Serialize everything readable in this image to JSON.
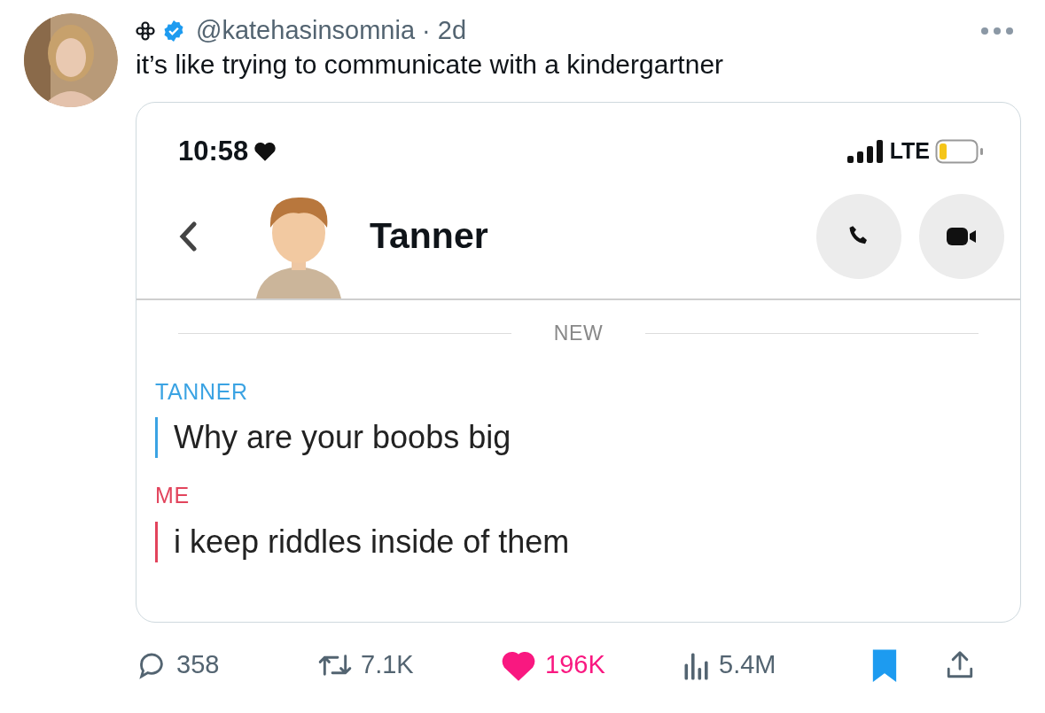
{
  "author": {
    "handle": "@katehasinsomnia",
    "separator": "·",
    "time": "2d",
    "verified": true
  },
  "tweet_text": "it’s like trying to communicate with a kindergartner",
  "embedded_screenshot": {
    "status_bar": {
      "time": "10:58",
      "network": "LTE"
    },
    "chat_header": {
      "contact_name": "Tanner"
    },
    "divider_label": "NEW",
    "messages": [
      {
        "sender": "TANNER",
        "text": "Why are your boobs big",
        "color": "#3ba3e3"
      },
      {
        "sender": "ME",
        "text": "i keep riddles inside of them",
        "color": "#e2445c"
      }
    ]
  },
  "actions": [
    {
      "kind": "reply",
      "count": "358",
      "on": false
    },
    {
      "kind": "retweet",
      "count": "7.1K",
      "on": false
    },
    {
      "kind": "like",
      "count": "196K",
      "on": true
    },
    {
      "kind": "views",
      "count": "5.4M",
      "on": false
    },
    {
      "kind": "bookmark",
      "on": true
    },
    {
      "kind": "share",
      "on": false
    }
  ]
}
